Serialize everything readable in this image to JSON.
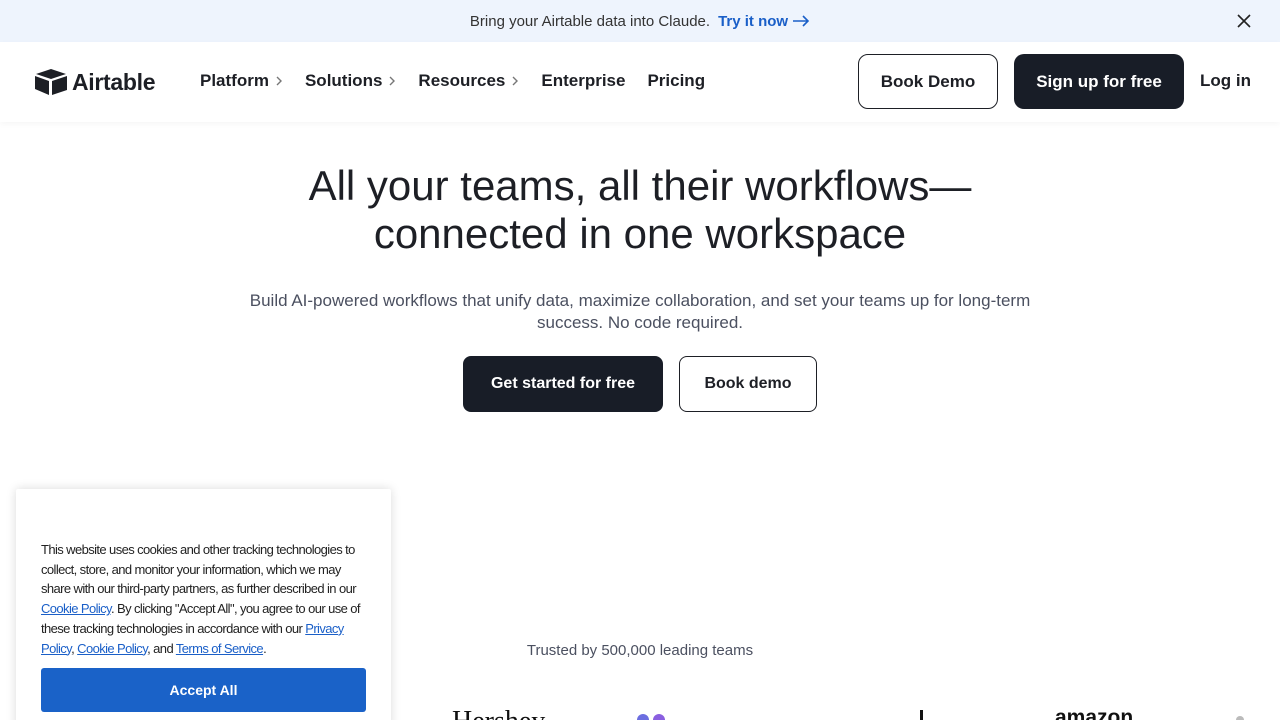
{
  "announcement": {
    "text": "Bring your Airtable data into Claude.",
    "cta_label": "Try it now",
    "close_icon": "close-icon"
  },
  "nav": {
    "brand": "Airtable",
    "items": [
      {
        "label": "Platform",
        "has_submenu": true
      },
      {
        "label": "Solutions",
        "has_submenu": true
      },
      {
        "label": "Resources",
        "has_submenu": true
      },
      {
        "label": "Enterprise",
        "has_submenu": false
      },
      {
        "label": "Pricing",
        "has_submenu": false
      }
    ],
    "book_demo_label": "Book Demo",
    "signup_label": "Sign up for free",
    "login_label": "Log in"
  },
  "hero": {
    "title_line1": "All your teams, all their workflows—",
    "title_line2": "connected in one workspace",
    "subtitle": "Build AI-powered workflows that unify data, maximize collaboration, and set your teams up for long-term success. No code required.",
    "primary_cta": "Get started for free",
    "secondary_cta": "Book demo"
  },
  "trusted": {
    "text": "Trusted by 500,000 leading teams",
    "logos": [
      "Hershey",
      "amazon"
    ]
  },
  "cookie_banner": {
    "text_part1": "This website uses cookies and other tracking technologies to collect, store, and monitor your information, which we may share with our third-party partners, as further described in our ",
    "link_cookie_policy_1": "Cookie Policy",
    "text_part2": ". By clicking \"Accept All\", you agree to our use of these tracking technologies in accordance with our ",
    "link_privacy_policy": "Privacy Policy",
    "sep1": ", ",
    "link_cookie_policy_2": "Cookie Policy",
    "sep2": ", and ",
    "link_terms": "Terms of Service",
    "end": ".",
    "accept_label": "Accept All"
  },
  "colors": {
    "announce_bg": "#eef4fd",
    "link_blue": "#1a5fc8",
    "dark_button": "#181d27",
    "accept_button": "#1a62c8"
  }
}
